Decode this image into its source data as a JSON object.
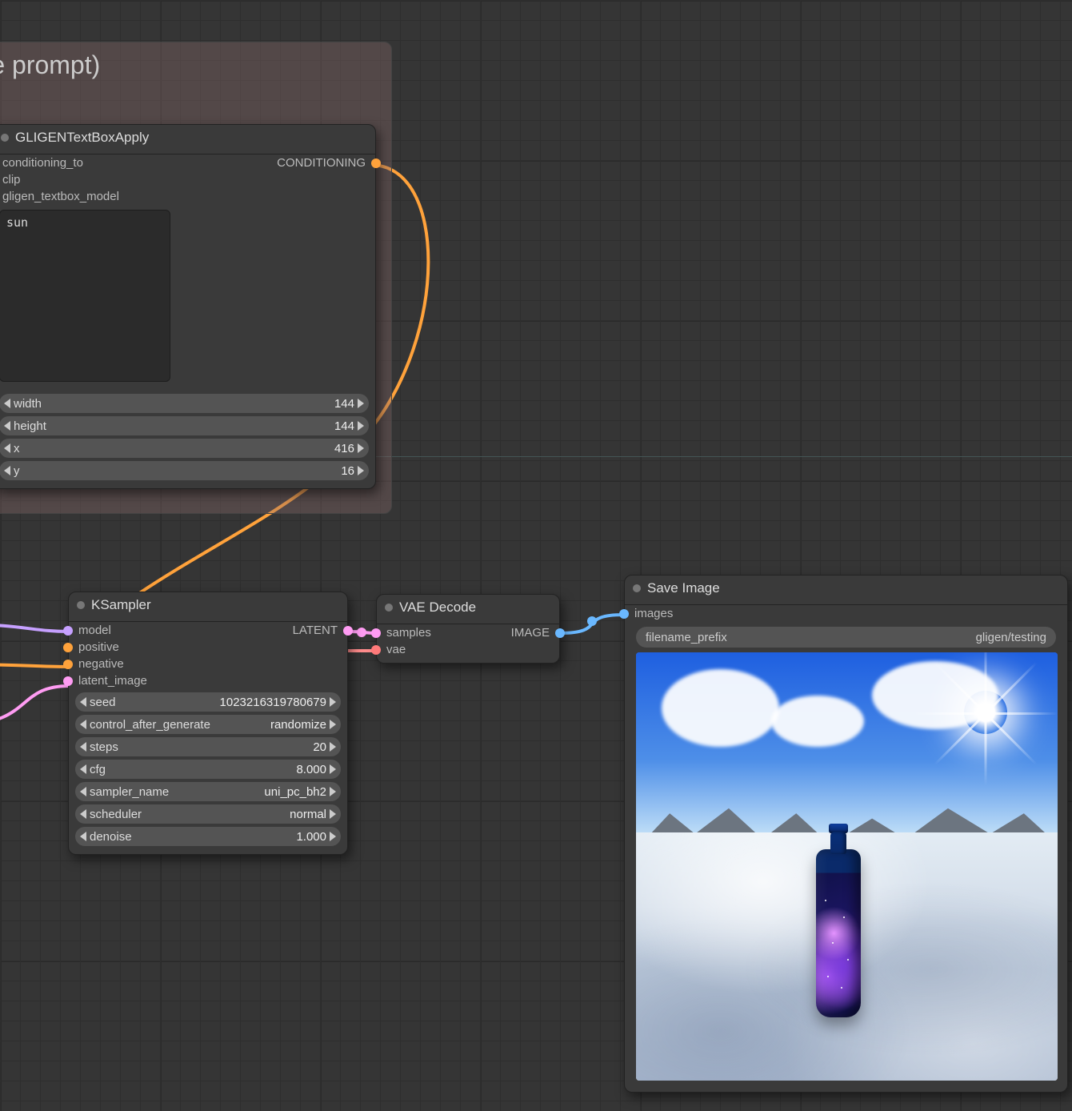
{
  "group": {
    "title": "ch some elements in the base prompt)"
  },
  "gligen": {
    "title": "GLIGENTextBoxApply",
    "inputs": {
      "conditioning_to": "conditioning_to",
      "clip": "clip",
      "model": "gligen_textbox_model"
    },
    "outputs": {
      "conditioning": "CONDITIONING"
    },
    "text": "sun",
    "params": [
      {
        "label": "width",
        "value": "144"
      },
      {
        "label": "height",
        "value": "144"
      },
      {
        "label": "x",
        "value": "416"
      },
      {
        "label": "y",
        "value": "16"
      }
    ]
  },
  "ksampler": {
    "title": "KSampler",
    "inputs": {
      "model": "model",
      "positive": "positive",
      "negative": "negative",
      "latent": "latent_image"
    },
    "outputs": {
      "latent": "LATENT"
    },
    "params": [
      {
        "label": "seed",
        "value": "1023216319780679"
      },
      {
        "label": "control_after_generate",
        "value": "randomize"
      },
      {
        "label": "steps",
        "value": "20"
      },
      {
        "label": "cfg",
        "value": "8.000"
      },
      {
        "label": "sampler_name",
        "value": "uni_pc_bh2"
      },
      {
        "label": "scheduler",
        "value": "normal"
      },
      {
        "label": "denoise",
        "value": "1.000"
      }
    ]
  },
  "vae": {
    "title": "VAE Decode",
    "inputs": {
      "samples": "samples",
      "vae": "vae"
    },
    "outputs": {
      "image": "IMAGE"
    }
  },
  "save": {
    "title": "Save Image",
    "inputs": {
      "images": "images"
    },
    "prefix_label": "filename_prefix",
    "prefix_value": "gligen/testing"
  },
  "colors": {
    "cond": "#ffa23b",
    "clip": "#ffe36b",
    "model": "#c6a0ff",
    "latent": "#ff9cf3",
    "vae": "#ff7a7a",
    "image": "#6ab8ff"
  }
}
